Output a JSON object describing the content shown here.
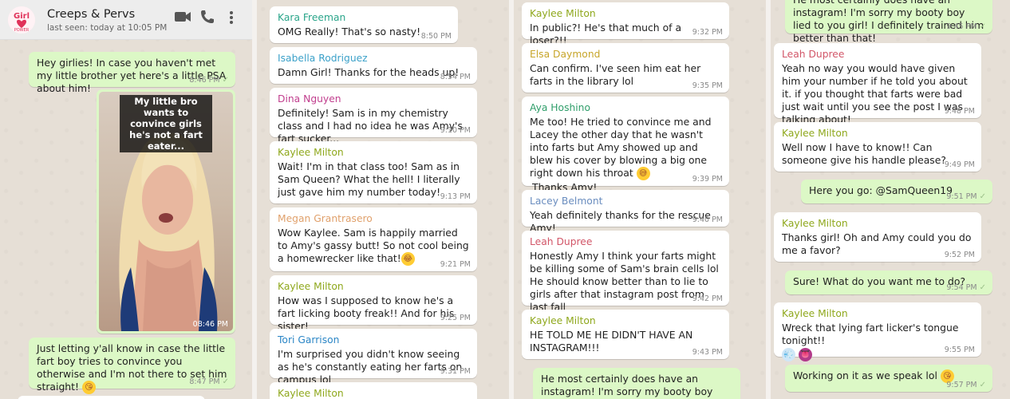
{
  "header": {
    "title": "Creeps & Pervs",
    "subtitle": "last seen: today at 10:05 PM",
    "logo_text": "Girl Power"
  },
  "col1": {
    "msg1": {
      "text": "Hey girlies! In case you haven't met my little brother yet here's a little PSA about him!",
      "time": "8:46 PM"
    },
    "video": {
      "caption": "My little bro wants to convince girls he's not a fart eater...",
      "time": "08:46 PM"
    },
    "msg2": {
      "text": "Just letting y'all know in case the little fart boy tries to convince you otherwise and I'm not there to set him straight!",
      "time": "8:47 PM"
    }
  },
  "col2": {
    "m1": {
      "sender": "Kara Freeman",
      "text": "OMG Really! That's so nasty!",
      "time": "8:50 PM"
    },
    "m2": {
      "sender": "Isabella Rodriguez",
      "text": "Damn Girl! Thanks for the heads up!",
      "time": "8:54 PM"
    },
    "m3": {
      "sender": "Dina Nguyen",
      "text": "Definitely! Sam is in my chemistry class and I had no idea he was Amy's fart sucker...",
      "time": "9:10 PM"
    },
    "m4": {
      "sender": "Kaylee Milton",
      "text": "Wait! I'm in that class too! Sam as in Sam Queen? What the hell! I literally just gave him my number today!",
      "time": "9:13 PM"
    },
    "m5": {
      "sender": "Megan Grantrasero",
      "text": "Wow Kaylee. Sam is happily married to Amy's gassy butt! So not cool being a homewrecker like that!",
      "time": "9:21 PM"
    },
    "m6": {
      "sender": "Kaylee Milton",
      "text": "How was I supposed to know he's a fart licking booty freak!! And for his sister!",
      "time": "9:25 PM"
    },
    "m7": {
      "sender": "Tori Garrison",
      "text": "I'm surprised you didn't know seeing as he's constantly eating her farts on campus lol",
      "time": "9:31 PM"
    },
    "m8": {
      "sender": "Kaylee Milton"
    }
  },
  "col3": {
    "m1": {
      "sender": "Kaylee Milton",
      "text": "In public?! He's that much of a loser?!!",
      "time": "9:32 PM"
    },
    "m2": {
      "sender": "Elsa Daymond",
      "text": "Can confirm. I've seen him eat her farts in the library lol",
      "time": "9:35 PM"
    },
    "m3": {
      "sender": "Aya Hoshino",
      "text": "Me too! He tried to convince me and Lacey the other day that he wasn't into farts but Amy showed up and blew his cover by blowing a big one right down his throat",
      "text2": "Thanks Amy!",
      "time": "9:39 PM"
    },
    "m4": {
      "sender": "Lacey Belmont",
      "text": "Yeah definitely thanks for the rescue Amy!",
      "time": "9:40 PM"
    },
    "m5": {
      "sender": "Leah Dupree",
      "text": "Honestly Amy I think your farts might be killing some of Sam's brain cells lol He should know better than to lie to girls after that instagram post from last fall",
      "time": "9:42 PM"
    },
    "m6": {
      "sender": "Kaylee Milton",
      "text": "HE TOLD ME HE DIDN'T HAVE AN INSTAGRAM!!!",
      "time": "9:43 PM"
    },
    "m7": {
      "text": "He most certainly does have an instagram! I'm sorry my booty boy lied to you girl! I"
    }
  },
  "col4": {
    "m0": {
      "text": "He most certainly does have an instagram! I'm sorry my booty boy lied to you girl! I definitely trained him better than that!",
      "time": "9:45 PM"
    },
    "m1": {
      "sender": "Leah Dupree",
      "text": "Yeah no way you would have given him your number if he told you about it. if you thought that farts were bad just wait until you see the post I was talking about!",
      "time": "9:48 PM"
    },
    "m2": {
      "sender": "Kaylee Milton",
      "text": "Well now I have to know!! Can someone give his handle please?",
      "time": "9:49 PM"
    },
    "m3": {
      "text": "Here you go: @SamQueen19",
      "time": "9:51 PM"
    },
    "m4": {
      "sender": "Kaylee Milton",
      "text": "Thanks girl! Oh and Amy could you do me a favor?",
      "time": "9:52 PM"
    },
    "m5": {
      "text": "Sure! What do you want me to do?",
      "time": "9:54 PM"
    },
    "m6": {
      "sender": "Kaylee Milton",
      "text": "Wreck that lying fart licker's tongue tonight!!",
      "time": "9:55 PM"
    },
    "m7": {
      "text": "Working on it as we speak lol",
      "time": "9:57 PM"
    }
  },
  "icons": [
    "video-call-icon",
    "phone-icon",
    "more-vert-icon",
    "read-check-icon"
  ],
  "colors": {
    "incoming": "#ffffff",
    "outgoing": "#dcf8c6",
    "background": "#e6dfd6",
    "kara": "#2aa58a",
    "isabella": "#3ba1c9",
    "dina": "#c13e8e",
    "kaylee": "#8fa81d",
    "megan": "#e0a06b",
    "tori": "#2b86c6",
    "elsa": "#c7a52a",
    "aya": "#2f9e6a",
    "lacey": "#6a8dbf",
    "leah": "#d25668"
  }
}
